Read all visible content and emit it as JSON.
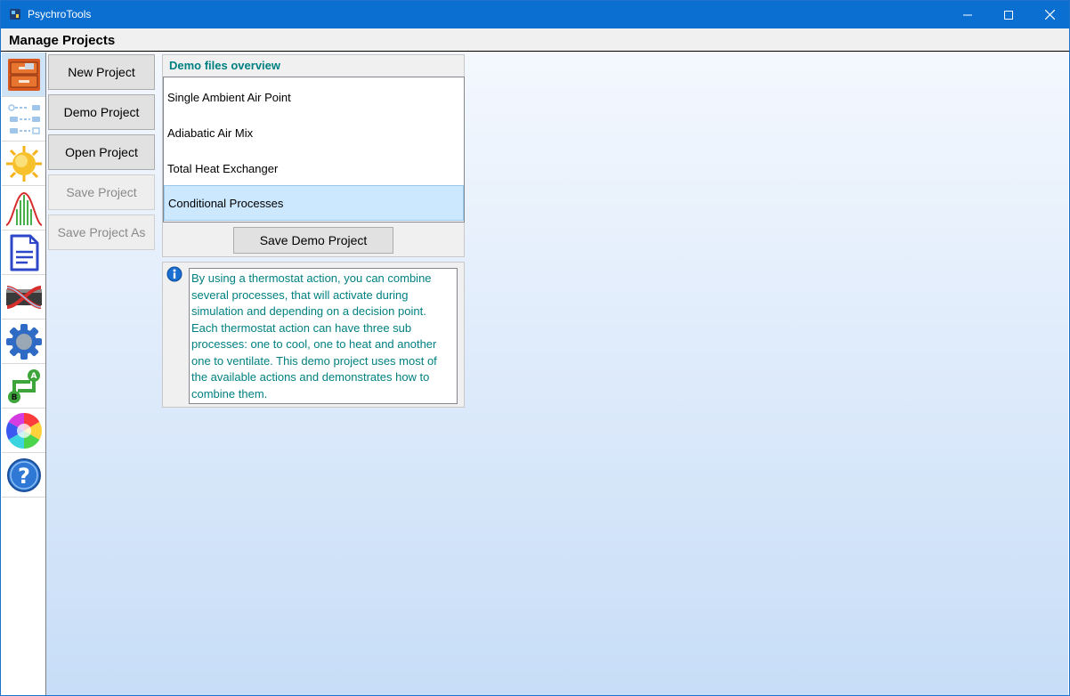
{
  "window": {
    "title": "PsychroTools"
  },
  "header": {
    "title": "Manage Projects"
  },
  "sidebar": {
    "items": [
      {
        "name": "projects",
        "icon": "filing-cabinet-icon",
        "active": true
      },
      {
        "name": "processes",
        "icon": "process-flow-icon"
      },
      {
        "name": "climate",
        "icon": "sun-icon"
      },
      {
        "name": "distribution",
        "icon": "bell-curve-icon"
      },
      {
        "name": "report",
        "icon": "document-icon"
      },
      {
        "name": "heat-exchanger",
        "icon": "heat-exchanger-icon"
      },
      {
        "name": "settings",
        "icon": "gear-icon"
      },
      {
        "name": "conversion",
        "icon": "a-b-conversion-icon"
      },
      {
        "name": "colors",
        "icon": "color-wheel-icon"
      },
      {
        "name": "help",
        "icon": "help-icon"
      }
    ]
  },
  "actions": {
    "new_project": "New Project",
    "demo_project": "Demo Project",
    "open_project": "Open Project",
    "save_project": "Save Project",
    "save_project_as": "Save Project As"
  },
  "demo": {
    "header": "Demo files overview",
    "files": [
      "Single Ambient Air Point",
      "Adiabatic Air Mix",
      "Total Heat Exchanger",
      "Conditional Processes"
    ],
    "selected_index": 3,
    "save_button": "Save Demo Project",
    "description": "By using a thermostat action, you can combine several processes, that will activate during simulation and depending on a decision point. Each thermostat action can have three sub processes: one to cool, one to heat and another one to ventilate. This demo project uses most of the available actions and demonstrates how to combine them."
  },
  "colors": {
    "titlebar": "#0b6fd1",
    "accent_text": "#008080",
    "selection": "#cce8ff"
  }
}
